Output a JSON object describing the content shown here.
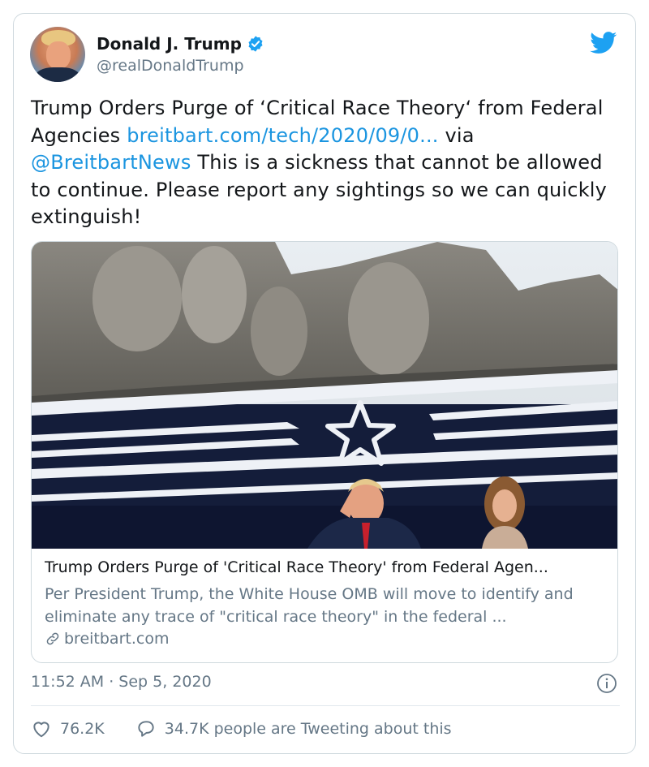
{
  "author": {
    "display_name": "Donald J. Trump",
    "handle": "@realDonaldTrump",
    "verified": true
  },
  "tweet": {
    "text_before_link": "Trump Orders Purge of ‘Critical Race Theory‘ from Federal Agencies ",
    "link_text": "breitbart.com/tech/2020/09/0...",
    "text_via": " via ",
    "mention": "@BreitbartNews",
    "text_after": "  This is a sickness that cannot be allowed to continue. Please report any sightings so we can quickly extinguish!"
  },
  "card": {
    "title": "Trump Orders Purge of 'Critical Race Theory' from Federal Agen...",
    "description": "Per President Trump, the White House OMB will move to identify and eliminate any trace of \"critical race theory\" in the federal ...",
    "domain": "breitbart.com"
  },
  "footer": {
    "timestamp": "11:52 AM · Sep 5, 2020",
    "likes": "76.2K",
    "conversation": "34.7K people are Tweeting about this"
  },
  "icons": {
    "verified": "verified-badge-icon",
    "brand": "twitter-bird-icon",
    "info": "info-icon",
    "like": "heart-icon",
    "reply": "speech-bubble-icon",
    "link": "link-icon"
  },
  "colors": {
    "link": "#1b95e0",
    "secondary_text": "#657786",
    "border": "#cfd9de",
    "verified": "#1da1f2"
  }
}
